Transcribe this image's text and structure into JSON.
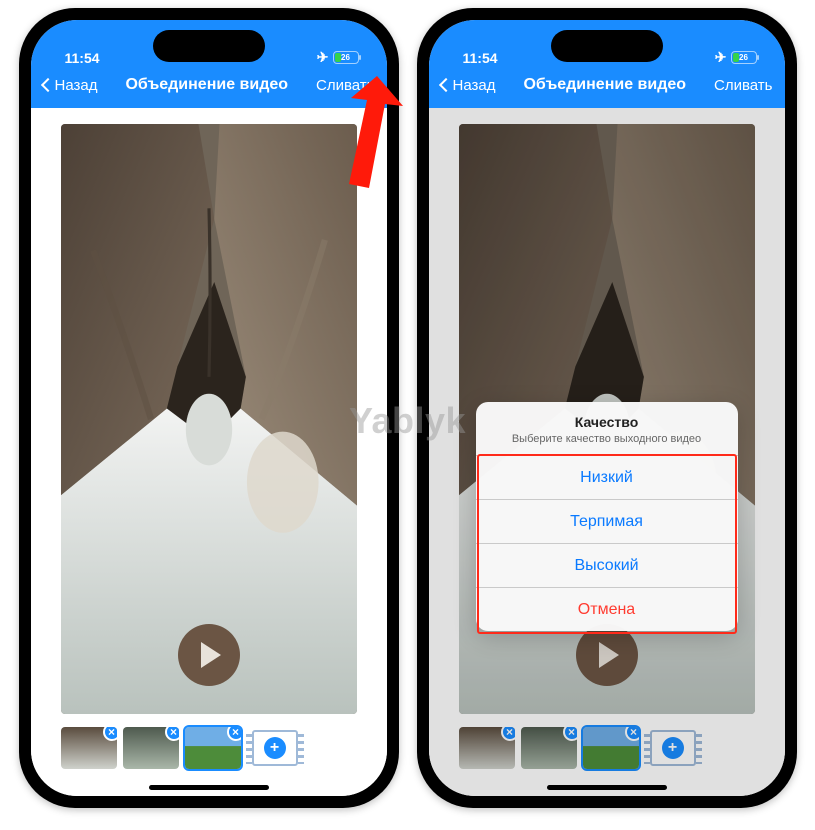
{
  "status": {
    "time": "11:54",
    "battery": "26"
  },
  "nav": {
    "back": "Назад",
    "title": "Объединение видео",
    "action": "Сливать"
  },
  "thumbs": {
    "items": [
      {
        "name": "clip-cave"
      },
      {
        "name": "clip-waterfall"
      },
      {
        "name": "clip-field"
      }
    ],
    "add_icon": "add-clip-icon"
  },
  "sheet": {
    "title": "Качество",
    "subtitle": "Выберите качество выходного видео",
    "options": [
      "Низкий",
      "Терпимая",
      "Высокий"
    ],
    "cancel": "Отмена"
  },
  "watermark": "Yablyk"
}
